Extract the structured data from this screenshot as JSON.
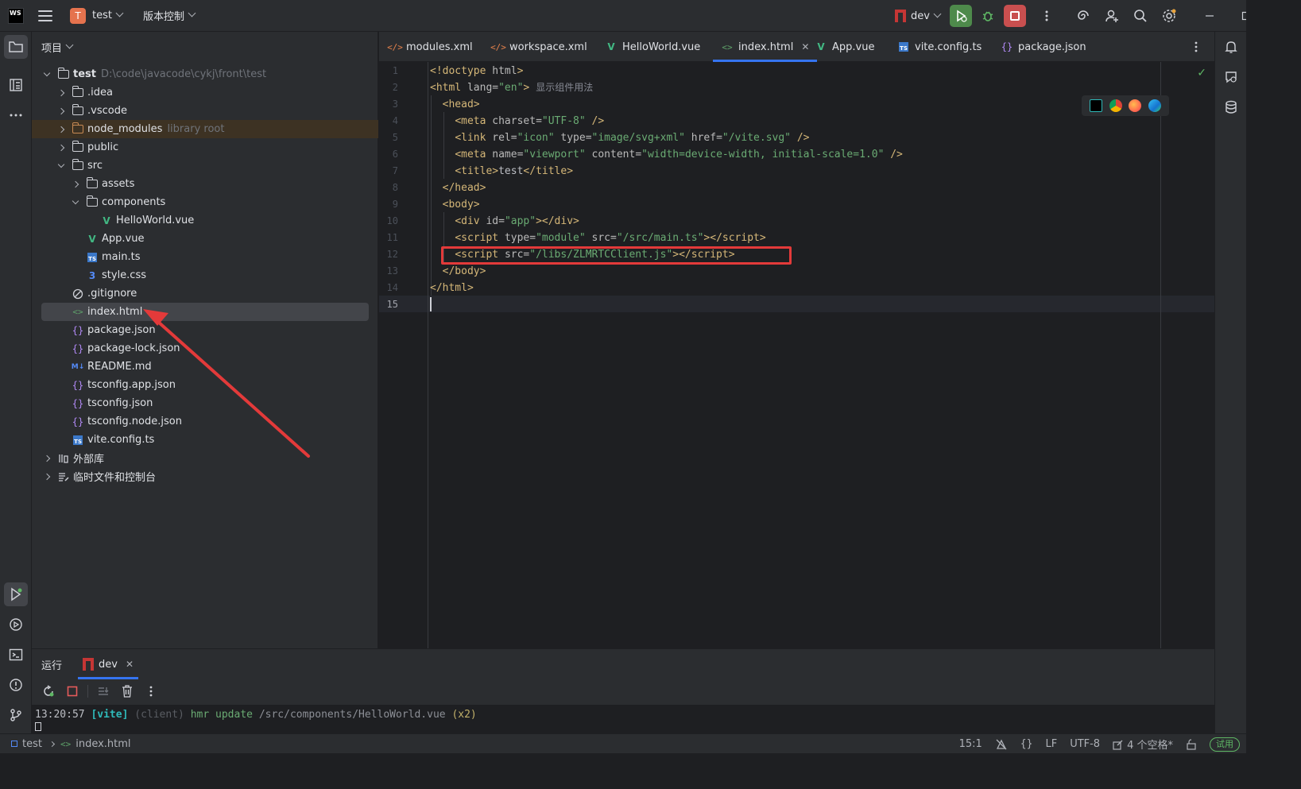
{
  "titlebar": {
    "logo_text": "WS",
    "project_badge": "T",
    "project_name": "test",
    "vcs_label": "版本控制",
    "run_config": "dev"
  },
  "project_panel": {
    "title": "项目",
    "root": {
      "name": "test",
      "path": "D:\\code\\javacode\\cykj\\front\\test"
    },
    "items": [
      {
        "label": ".idea"
      },
      {
        "label": ".vscode"
      },
      {
        "label": "node_modules",
        "note": "library root"
      },
      {
        "label": "public"
      },
      {
        "label": "src"
      },
      {
        "label": "assets"
      },
      {
        "label": "components"
      },
      {
        "label": "HelloWorld.vue"
      },
      {
        "label": "App.vue"
      },
      {
        "label": "main.ts"
      },
      {
        "label": "style.css"
      },
      {
        "label": ".gitignore"
      },
      {
        "label": "index.html"
      },
      {
        "label": "package.json"
      },
      {
        "label": "package-lock.json"
      },
      {
        "label": "README.md"
      },
      {
        "label": "tsconfig.app.json"
      },
      {
        "label": "tsconfig.json"
      },
      {
        "label": "tsconfig.node.json"
      },
      {
        "label": "vite.config.ts"
      },
      {
        "label": "外部库"
      },
      {
        "label": "临时文件和控制台"
      }
    ]
  },
  "tabs": [
    {
      "label": "modules.xml"
    },
    {
      "label": "workspace.xml"
    },
    {
      "label": "HelloWorld.vue"
    },
    {
      "label": "index.html"
    },
    {
      "label": "App.vue"
    },
    {
      "label": "vite.config.ts"
    },
    {
      "label": "package.json"
    }
  ],
  "editor": {
    "line_numbers": [
      "1",
      "2",
      "3",
      "4",
      "5",
      "6",
      "7",
      "8",
      "9",
      "10",
      "11",
      "12",
      "13",
      "14",
      "15"
    ],
    "inlay_hint": "显示组件用法"
  },
  "run_panel": {
    "title": "运行",
    "tab": "dev",
    "console": {
      "time": "13:20:57",
      "tag": "[vite]",
      "client": "(client)",
      "msg": "hmr update",
      "path": "/src/components/HelloWorld.vue",
      "count": "(x2)"
    }
  },
  "status": {
    "crumb_project": "test",
    "crumb_file": "index.html",
    "position": "15:1",
    "line_sep": "LF",
    "encoding": "UTF-8",
    "indent": "4 个空格*",
    "trial": "试用"
  },
  "colors": {
    "accent": "#3574f0",
    "highlight_box": "#e33a3a",
    "run_green": "#4e8a4b",
    "stop_red": "#c94f4f"
  }
}
